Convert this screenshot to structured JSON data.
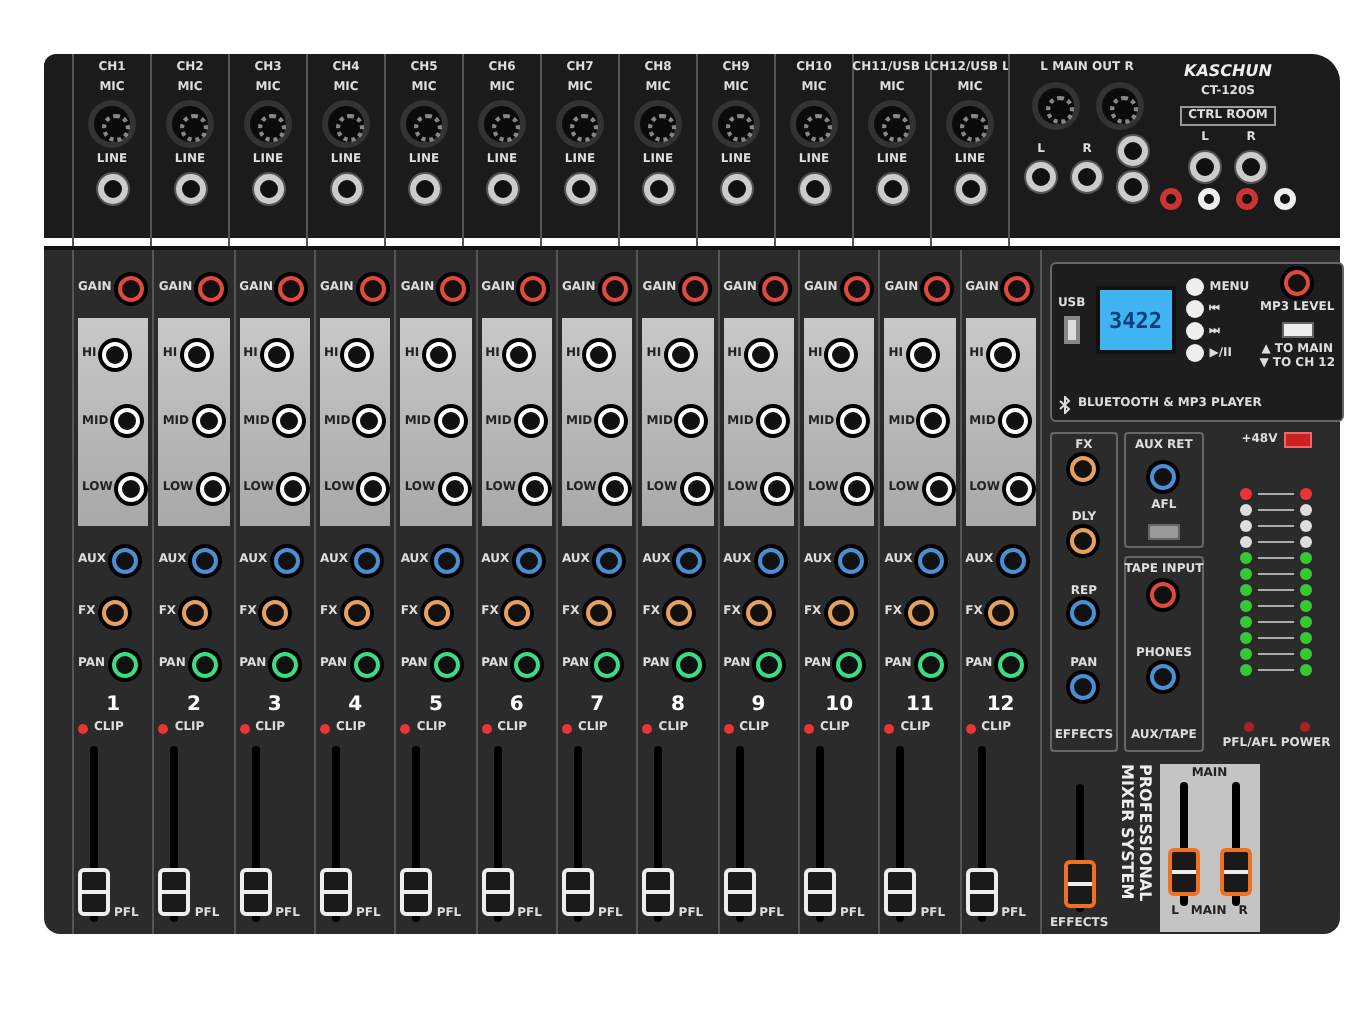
{
  "channels": [
    {
      "input": "CH1",
      "mic": "MIC",
      "line": "LINE",
      "gain": "GAIN",
      "eq": [
        "HI",
        "MID",
        "LOW"
      ],
      "sends": [
        {
          "label": "AUX",
          "color": "#4a8fd4"
        },
        {
          "label": "FX",
          "color": "#e8a060"
        },
        {
          "label": "PAN",
          "color": "#3ddc84"
        }
      ],
      "number": "1",
      "clip": "CLIP",
      "pfl": "PFL",
      "level": 0.05
    },
    {
      "input": "CH2",
      "mic": "MIC",
      "line": "LINE",
      "gain": "GAIN",
      "eq": [
        "HI",
        "MID",
        "LOW"
      ],
      "sends": [
        {
          "label": "AUX",
          "color": "#4a8fd4"
        },
        {
          "label": "FX",
          "color": "#e8a060"
        },
        {
          "label": "PAN",
          "color": "#3ddc84"
        }
      ],
      "number": "2",
      "clip": "CLIP",
      "pfl": "PFL",
      "level": 0.05
    },
    {
      "input": "CH3",
      "mic": "MIC",
      "line": "LINE",
      "gain": "GAIN",
      "eq": [
        "HI",
        "MID",
        "LOW"
      ],
      "sends": [
        {
          "label": "AUX",
          "color": "#4a8fd4"
        },
        {
          "label": "FX",
          "color": "#e8a060"
        },
        {
          "label": "PAN",
          "color": "#3ddc84"
        }
      ],
      "number": "3",
      "clip": "CLIP",
      "pfl": "PFL",
      "level": 0.05
    },
    {
      "input": "CH4",
      "mic": "MIC",
      "line": "LINE",
      "gain": "GAIN",
      "eq": [
        "HI",
        "MID",
        "LOW"
      ],
      "sends": [
        {
          "label": "AUX",
          "color": "#4a8fd4"
        },
        {
          "label": "FX",
          "color": "#e8a060"
        },
        {
          "label": "PAN",
          "color": "#3ddc84"
        }
      ],
      "number": "4",
      "clip": "CLIP",
      "pfl": "PFL",
      "level": 0.05
    },
    {
      "input": "CH5",
      "mic": "MIC",
      "line": "LINE",
      "gain": "GAIN",
      "eq": [
        "HI",
        "MID",
        "LOW"
      ],
      "sends": [
        {
          "label": "AUX",
          "color": "#4a8fd4"
        },
        {
          "label": "FX",
          "color": "#e8a060"
        },
        {
          "label": "PAN",
          "color": "#3ddc84"
        }
      ],
      "number": "5",
      "clip": "CLIP",
      "pfl": "PFL",
      "level": 0.05
    },
    {
      "input": "CH6",
      "mic": "MIC",
      "line": "LINE",
      "gain": "GAIN",
      "eq": [
        "HI",
        "MID",
        "LOW"
      ],
      "sends": [
        {
          "label": "AUX",
          "color": "#4a8fd4"
        },
        {
          "label": "FX",
          "color": "#e8a060"
        },
        {
          "label": "PAN",
          "color": "#3ddc84"
        }
      ],
      "number": "6",
      "clip": "CLIP",
      "pfl": "PFL",
      "level": 0.05
    },
    {
      "input": "CH7",
      "mic": "MIC",
      "line": "LINE",
      "gain": "GAIN",
      "eq": [
        "HI",
        "MID",
        "LOW"
      ],
      "sends": [
        {
          "label": "AUX",
          "color": "#4a8fd4"
        },
        {
          "label": "FX",
          "color": "#e8a060"
        },
        {
          "label": "PAN",
          "color": "#3ddc84"
        }
      ],
      "number": "7",
      "clip": "CLIP",
      "pfl": "PFL",
      "level": 0.05
    },
    {
      "input": "CH8",
      "mic": "MIC",
      "line": "LINE",
      "gain": "GAIN",
      "eq": [
        "HI",
        "MID",
        "LOW"
      ],
      "sends": [
        {
          "label": "AUX",
          "color": "#4a8fd4"
        },
        {
          "label": "FX",
          "color": "#e8a060"
        },
        {
          "label": "PAN",
          "color": "#3ddc84"
        }
      ],
      "number": "8",
      "clip": "CLIP",
      "pfl": "PFL",
      "level": 0.05
    },
    {
      "input": "CH9",
      "mic": "MIC",
      "line": "LINE",
      "gain": "GAIN",
      "eq": [
        "HI",
        "MID",
        "LOW"
      ],
      "sends": [
        {
          "label": "AUX",
          "color": "#4a8fd4"
        },
        {
          "label": "FX",
          "color": "#e8a060"
        },
        {
          "label": "PAN",
          "color": "#3ddc84"
        }
      ],
      "number": "9",
      "clip": "CLIP",
      "pfl": "PFL",
      "level": 0.05
    },
    {
      "input": "CH10",
      "mic": "MIC",
      "line": "LINE",
      "gain": "GAIN",
      "eq": [
        "HI",
        "MID",
        "LOW"
      ],
      "sends": [
        {
          "label": "AUX",
          "color": "#4a8fd4"
        },
        {
          "label": "FX",
          "color": "#e8a060"
        },
        {
          "label": "PAN",
          "color": "#3ddc84"
        }
      ],
      "number": "10",
      "clip": "CLIP",
      "pfl": "PFL",
      "level": 0.05
    },
    {
      "input": "CH11/USB L",
      "mic": "MIC",
      "line": "LINE",
      "gain": "GAIN",
      "eq": [
        "HI",
        "MID",
        "LOW"
      ],
      "sends": [
        {
          "label": "AUX",
          "color": "#4a8fd4"
        },
        {
          "label": "FX",
          "color": "#e8a060"
        },
        {
          "label": "PAN",
          "color": "#3ddc84"
        }
      ],
      "number": "11",
      "clip": "CLIP",
      "pfl": "PFL",
      "level": 0.05
    },
    {
      "input": "CH12/USB L",
      "mic": "MIC",
      "line": "LINE",
      "gain": "GAIN",
      "eq": [
        "HI",
        "MID",
        "LOW"
      ],
      "sends": [
        {
          "label": "AUX",
          "color": "#4a8fd4"
        },
        {
          "label": "FX",
          "color": "#e8a060"
        },
        {
          "label": "PAN",
          "color": "#3ddc84"
        }
      ],
      "number": "12",
      "clip": "CLIP",
      "pfl": "PFL",
      "level": 0.05
    }
  ],
  "rear_right": {
    "main_out": "L MAIN OUT R",
    "out_jacks": [
      "L",
      "R"
    ],
    "brand": "KASCHUN",
    "model": "CT-120S",
    "ctrl_room": "CTRL ROOM",
    "ctrl_room_jacks": [
      "L",
      "R"
    ]
  },
  "player": {
    "usb": "USB",
    "display": "3422",
    "buttons": [
      "MENU",
      "⏮",
      "⏭",
      "▶/II"
    ],
    "level_label": "MP3 LEVEL",
    "switch_labels": [
      "▲ TO MAIN",
      "▼ TO CH 12"
    ],
    "switch_on": true,
    "title": "BLUETOOTH & MP3 PLAYER"
  },
  "effects": {
    "knobs": [
      {
        "label": "FX",
        "color": "#e8a060"
      },
      {
        "label": "DLY",
        "color": "#e8a060"
      },
      {
        "label": "REP",
        "color": "#4a8fd4"
      },
      {
        "label": "PAN",
        "color": "#4a8fd4"
      }
    ],
    "title": "EFFECTS"
  },
  "aux_return": {
    "knob": "AUX RET",
    "switch": "AFL",
    "afl_on": false
  },
  "aux_tape": {
    "knobs": [
      {
        "label": "TAPE INPUT",
        "color": "#e04a3a"
      },
      {
        "label": "PHONES",
        "color": "#4a8fd4"
      }
    ],
    "title": "AUX/TAPE"
  },
  "phantom": {
    "label": "+48V",
    "on": true
  },
  "meter_labels": [
    "PFL/AFL",
    "POWER"
  ],
  "effects_fader": {
    "label": "EFFECTS",
    "level": 0.05
  },
  "slogan": [
    "PROFESSIONAL",
    "MIXER SYSTEM"
  ],
  "main": {
    "title": "MAIN",
    "labels": [
      "L",
      "MAIN",
      "R"
    ],
    "faders": [
      {
        "level": 0.12
      },
      {
        "level": 0.12
      }
    ]
  }
}
